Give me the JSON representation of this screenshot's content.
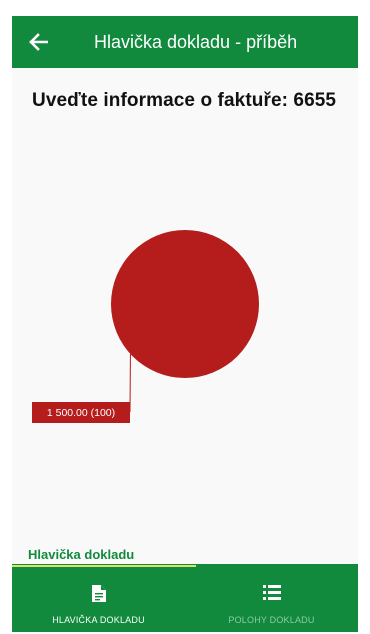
{
  "colors": {
    "primary": "#118a3e",
    "slice": "#b51c1c",
    "tab_indicator": "#d6e46a",
    "inactive_nav": "#8fc9a2"
  },
  "app_bar": {
    "back_icon": "arrow-left-icon",
    "title": "Hlavička dokladu - příběh"
  },
  "heading": "Uveďte informace o faktuře: 6655",
  "chart_data": {
    "type": "pie",
    "slices": [
      {
        "value": 1500.0,
        "percent": 100,
        "label": "1 500.00 (100)"
      }
    ]
  },
  "section_tab": "Hlavička dokladu",
  "bottom_nav": {
    "items": [
      {
        "label": "HLAVIČKA DOKLADU",
        "icon": "document-icon",
        "active": true
      },
      {
        "label": "POLOHY DOKLADU",
        "icon": "list-icon",
        "active": false
      }
    ]
  }
}
